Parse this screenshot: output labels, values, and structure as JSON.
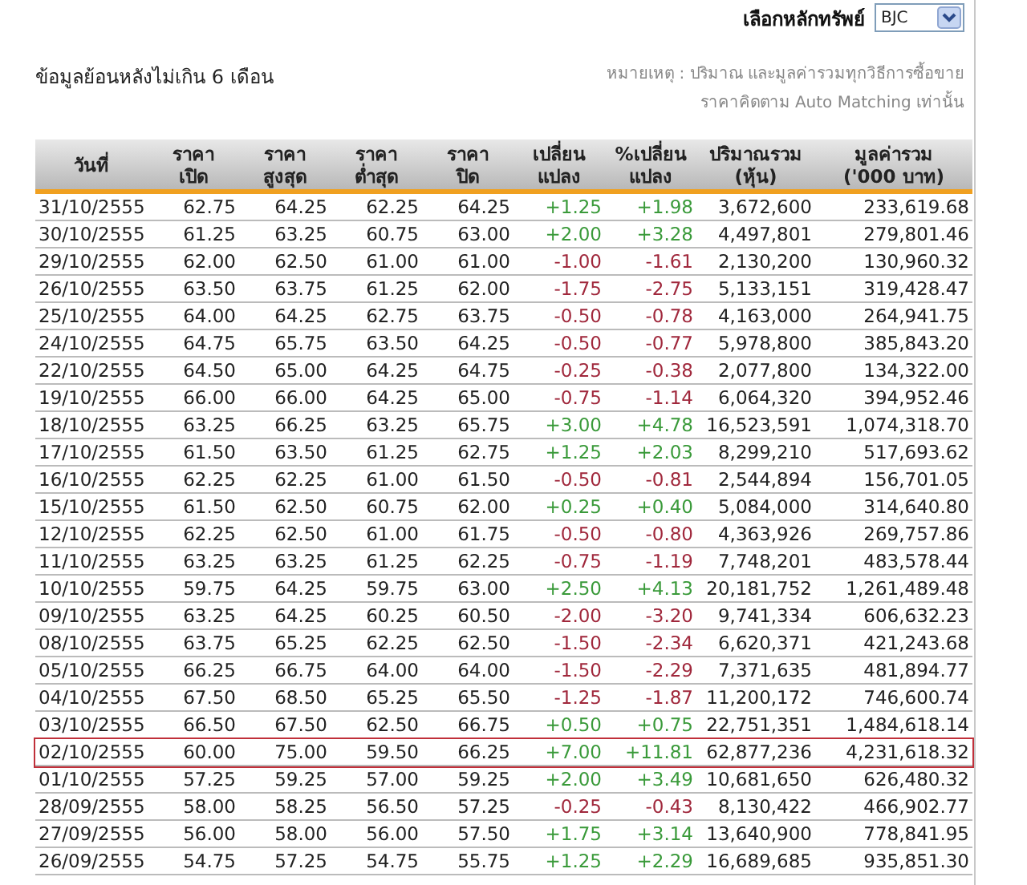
{
  "security_select": {
    "label": "เลือกหลักทรัพย์",
    "value": "BJC"
  },
  "period_note": "ข้อมูลย้อนหลังไม่เกิน 6 เดือน",
  "remark_lines": [
    "หมายเหตุ : ปริมาณ และมูลค่ารวมทุกวิธีการซื้อขาย",
    "ราคาคิดตาม Auto Matching เท่านั้น"
  ],
  "table": {
    "columns": [
      [
        "วันที่"
      ],
      [
        "ราคา",
        "เปิด"
      ],
      [
        "ราคา",
        "สูงสุด"
      ],
      [
        "ราคา",
        "ต่ำสุด"
      ],
      [
        "ราคา",
        "ปิด"
      ],
      [
        "เปลี่ยน",
        "แปลง"
      ],
      [
        "%เปลี่ยน",
        "แปลง"
      ],
      [
        "ปริมาณรวม",
        "(หุ้น)"
      ],
      [
        "มูลค่ารวม",
        "('000 บาท)"
      ]
    ],
    "rows": [
      {
        "date": "31/10/2555",
        "open": "62.75",
        "high": "64.25",
        "low": "62.25",
        "close": "64.25",
        "change": "+1.25",
        "pct_change": "+1.98",
        "volume": "3,672,600",
        "value": "233,619.68",
        "gain": true,
        "selected": false
      },
      {
        "date": "30/10/2555",
        "open": "61.25",
        "high": "63.25",
        "low": "60.75",
        "close": "63.00",
        "change": "+2.00",
        "pct_change": "+3.28",
        "volume": "4,497,801",
        "value": "279,801.46",
        "gain": true,
        "selected": false
      },
      {
        "date": "29/10/2555",
        "open": "62.00",
        "high": "62.50",
        "low": "61.00",
        "close": "61.00",
        "change": "-1.00",
        "pct_change": "-1.61",
        "volume": "2,130,200",
        "value": "130,960.32",
        "gain": false,
        "selected": false
      },
      {
        "date": "26/10/2555",
        "open": "63.50",
        "high": "63.75",
        "low": "61.25",
        "close": "62.00",
        "change": "-1.75",
        "pct_change": "-2.75",
        "volume": "5,133,151",
        "value": "319,428.47",
        "gain": false,
        "selected": false
      },
      {
        "date": "25/10/2555",
        "open": "64.00",
        "high": "64.25",
        "low": "62.75",
        "close": "63.75",
        "change": "-0.50",
        "pct_change": "-0.78",
        "volume": "4,163,000",
        "value": "264,941.75",
        "gain": false,
        "selected": false
      },
      {
        "date": "24/10/2555",
        "open": "64.75",
        "high": "65.75",
        "low": "63.50",
        "close": "64.25",
        "change": "-0.50",
        "pct_change": "-0.77",
        "volume": "5,978,800",
        "value": "385,843.20",
        "gain": false,
        "selected": false
      },
      {
        "date": "22/10/2555",
        "open": "64.50",
        "high": "65.00",
        "low": "64.25",
        "close": "64.75",
        "change": "-0.25",
        "pct_change": "-0.38",
        "volume": "2,077,800",
        "value": "134,322.00",
        "gain": false,
        "selected": false
      },
      {
        "date": "19/10/2555",
        "open": "66.00",
        "high": "66.00",
        "low": "64.25",
        "close": "65.00",
        "change": "-0.75",
        "pct_change": "-1.14",
        "volume": "6,064,320",
        "value": "394,952.46",
        "gain": false,
        "selected": false
      },
      {
        "date": "18/10/2555",
        "open": "63.25",
        "high": "66.25",
        "low": "63.25",
        "close": "65.75",
        "change": "+3.00",
        "pct_change": "+4.78",
        "volume": "16,523,591",
        "value": "1,074,318.70",
        "gain": true,
        "selected": false
      },
      {
        "date": "17/10/2555",
        "open": "61.50",
        "high": "63.50",
        "low": "61.25",
        "close": "62.75",
        "change": "+1.25",
        "pct_change": "+2.03",
        "volume": "8,299,210",
        "value": "517,693.62",
        "gain": true,
        "selected": false
      },
      {
        "date": "16/10/2555",
        "open": "62.25",
        "high": "62.25",
        "low": "61.00",
        "close": "61.50",
        "change": "-0.50",
        "pct_change": "-0.81",
        "volume": "2,544,894",
        "value": "156,701.05",
        "gain": false,
        "selected": false
      },
      {
        "date": "15/10/2555",
        "open": "61.50",
        "high": "62.50",
        "low": "60.75",
        "close": "62.00",
        "change": "+0.25",
        "pct_change": "+0.40",
        "volume": "5,084,000",
        "value": "314,640.80",
        "gain": true,
        "selected": false
      },
      {
        "date": "12/10/2555",
        "open": "62.25",
        "high": "62.50",
        "low": "61.00",
        "close": "61.75",
        "change": "-0.50",
        "pct_change": "-0.80",
        "volume": "4,363,926",
        "value": "269,757.86",
        "gain": false,
        "selected": false
      },
      {
        "date": "11/10/2555",
        "open": "63.25",
        "high": "63.25",
        "low": "61.25",
        "close": "62.25",
        "change": "-0.75",
        "pct_change": "-1.19",
        "volume": "7,748,201",
        "value": "483,578.44",
        "gain": false,
        "selected": false
      },
      {
        "date": "10/10/2555",
        "open": "59.75",
        "high": "64.25",
        "low": "59.75",
        "close": "63.00",
        "change": "+2.50",
        "pct_change": "+4.13",
        "volume": "20,181,752",
        "value": "1,261,489.48",
        "gain": true,
        "selected": false
      },
      {
        "date": "09/10/2555",
        "open": "63.25",
        "high": "64.25",
        "low": "60.25",
        "close": "60.50",
        "change": "-2.00",
        "pct_change": "-3.20",
        "volume": "9,741,334",
        "value": "606,632.23",
        "gain": false,
        "selected": false
      },
      {
        "date": "08/10/2555",
        "open": "63.75",
        "high": "65.25",
        "low": "62.25",
        "close": "62.50",
        "change": "-1.50",
        "pct_change": "-2.34",
        "volume": "6,620,371",
        "value": "421,243.68",
        "gain": false,
        "selected": false
      },
      {
        "date": "05/10/2555",
        "open": "66.25",
        "high": "66.75",
        "low": "64.00",
        "close": "64.00",
        "change": "-1.50",
        "pct_change": "-2.29",
        "volume": "7,371,635",
        "value": "481,894.77",
        "gain": false,
        "selected": false
      },
      {
        "date": "04/10/2555",
        "open": "67.50",
        "high": "68.50",
        "low": "65.25",
        "close": "65.50",
        "change": "-1.25",
        "pct_change": "-1.87",
        "volume": "11,200,172",
        "value": "746,600.74",
        "gain": false,
        "selected": false
      },
      {
        "date": "03/10/2555",
        "open": "66.50",
        "high": "67.50",
        "low": "62.50",
        "close": "66.75",
        "change": "+0.50",
        "pct_change": "+0.75",
        "volume": "22,751,351",
        "value": "1,484,618.14",
        "gain": true,
        "selected": false
      },
      {
        "date": "02/10/2555",
        "open": "60.00",
        "high": "75.00",
        "low": "59.50",
        "close": "66.25",
        "change": "+7.00",
        "pct_change": "+11.81",
        "volume": "62,877,236",
        "value": "4,231,618.32",
        "gain": true,
        "selected": true
      },
      {
        "date": "01/10/2555",
        "open": "57.25",
        "high": "59.25",
        "low": "57.00",
        "close": "59.25",
        "change": "+2.00",
        "pct_change": "+3.49",
        "volume": "10,681,650",
        "value": "626,480.32",
        "gain": true,
        "selected": false
      },
      {
        "date": "28/09/2555",
        "open": "58.00",
        "high": "58.25",
        "low": "56.50",
        "close": "57.25",
        "change": "-0.25",
        "pct_change": "-0.43",
        "volume": "8,130,422",
        "value": "466,902.77",
        "gain": false,
        "selected": false
      },
      {
        "date": "27/09/2555",
        "open": "56.00",
        "high": "58.00",
        "low": "56.00",
        "close": "57.50",
        "change": "+1.75",
        "pct_change": "+3.14",
        "volume": "13,640,900",
        "value": "778,841.95",
        "gain": true,
        "selected": false
      },
      {
        "date": "26/09/2555",
        "open": "54.75",
        "high": "57.25",
        "low": "54.75",
        "close": "55.75",
        "change": "+1.25",
        "pct_change": "+2.29",
        "volume": "16,689,685",
        "value": "935,851.30",
        "gain": true,
        "selected": false
      }
    ]
  }
}
